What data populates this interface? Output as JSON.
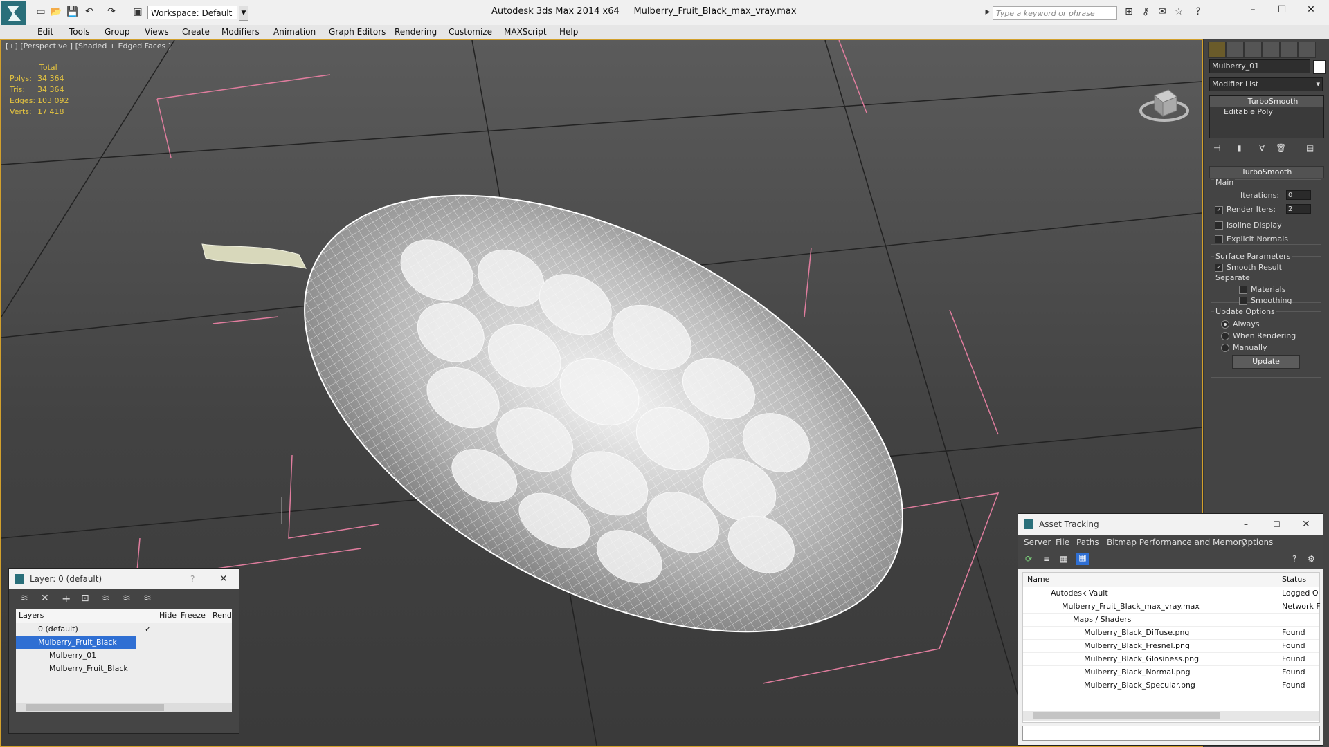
{
  "titlebar": {
    "workspace": "Workspace: Default",
    "app": "Autodesk 3ds Max  2014 x64",
    "file": "Mulberry_Fruit_Black_max_vray.max",
    "search_placeholder": "Type a keyword or phrase"
  },
  "menu": [
    "Edit",
    "Tools",
    "Group",
    "Views",
    "Create",
    "Modifiers",
    "Animation",
    "Graph Editors",
    "Rendering",
    "Customize",
    "MAXScript",
    "Help"
  ],
  "viewport": {
    "label": "[+] [Perspective ] [Shaded + Edged Faces ]",
    "stats_header": "Total",
    "stats": [
      {
        "k": "Polys:",
        "v": "34 364"
      },
      {
        "k": "Tris:",
        "v": "34 364"
      },
      {
        "k": "Edges:",
        "v": "103 092"
      },
      {
        "k": "Verts:",
        "v": "17 418"
      }
    ]
  },
  "cmdpanel": {
    "object_name": "Mulberry_01",
    "modifier_list": "Modifier List",
    "stack": [
      "TurboSmooth",
      "Editable Poly"
    ],
    "rollout_title": "TurboSmooth",
    "main_label": "Main",
    "iterations_label": "Iterations:",
    "iterations_value": "0",
    "render_iters_label": "Render Iters:",
    "render_iters_value": "2",
    "isoline": "Isoline Display",
    "explicit": "Explicit Normals",
    "surface_params": "Surface Parameters",
    "smooth_result": "Smooth Result",
    "separate": "Separate",
    "materials": "Materials",
    "smoothing_groups": "Smoothing Groups",
    "update_options": "Update Options",
    "always": "Always",
    "when_rendering": "When Rendering",
    "manually": "Manually",
    "update_btn": "Update"
  },
  "layer_win": {
    "title": "Layer: 0 (default)",
    "help": "?",
    "cols": {
      "layers": "Layers",
      "hide": "Hide",
      "freeze": "Freeze",
      "render": "Rend"
    },
    "rows": [
      {
        "name": "0 (default)",
        "indent": 0,
        "selected": false
      },
      {
        "name": "Mulberry_Fruit_Black",
        "indent": 0,
        "selected": true
      },
      {
        "name": "Mulberry_01",
        "indent": 1,
        "selected": false
      },
      {
        "name": "Mulberry_Fruit_Black",
        "indent": 1,
        "selected": false
      }
    ]
  },
  "asset_win": {
    "title": "Asset Tracking",
    "menu": [
      "Server",
      "File",
      "Paths",
      "Bitmap Performance and Memory",
      "Options"
    ],
    "cols": {
      "name": "Name",
      "status": "Status"
    },
    "rows": [
      {
        "name": "Autodesk Vault",
        "status": "Logged O",
        "indent": 1
      },
      {
        "name": "Mulberry_Fruit_Black_max_vray.max",
        "status": "Network F",
        "indent": 2
      },
      {
        "name": "Maps / Shaders",
        "status": "",
        "indent": 3
      },
      {
        "name": "Mulberry_Black_Diffuse.png",
        "status": "Found",
        "indent": 4
      },
      {
        "name": "Mulberry_Black_Fresnel.png",
        "status": "Found",
        "indent": 4
      },
      {
        "name": "Mulberry_Black_Glosiness.png",
        "status": "Found",
        "indent": 4
      },
      {
        "name": "Mulberry_Black_Normal.png",
        "status": "Found",
        "indent": 4
      },
      {
        "name": "Mulberry_Black_Specular.png",
        "status": "Found",
        "indent": 4
      }
    ]
  },
  "colors": {
    "accent": "#d2a02c",
    "stats": "#e5c440",
    "selection": "#2f6fd3",
    "wire": "#e1e1e1"
  }
}
